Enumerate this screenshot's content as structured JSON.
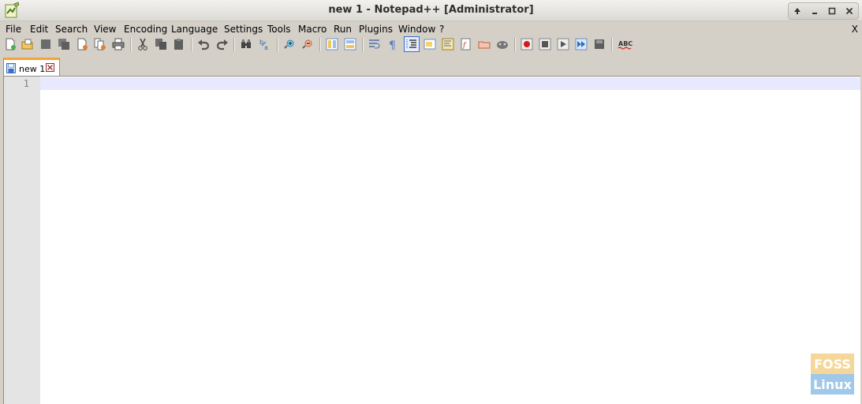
{
  "window": {
    "title": "new 1 - Notepad++ [Administrator]",
    "buttons": [
      "↑",
      "−",
      "□",
      "✕"
    ]
  },
  "menu": {
    "items": [
      "File",
      "Edit",
      "Search",
      "View",
      "Encoding",
      "Language",
      "Settings",
      "Tools",
      "Macro",
      "Run",
      "Plugins",
      "Window",
      "?"
    ],
    "close_label": "X"
  },
  "toolbar": {
    "icons": [
      "new-file-icon",
      "open-file-icon",
      "save-icon",
      "save-all-icon",
      "close-icon",
      "close-all-icon",
      "print-icon",
      "cut-icon",
      "copy-icon",
      "paste-icon",
      "undo-icon",
      "redo-icon",
      "find-icon",
      "replace-icon",
      "zoom-in-icon",
      "zoom-out-icon",
      "sync-vertical-icon",
      "sync-horizontal-icon",
      "word-wrap-icon",
      "show-all-chars-icon",
      "indent-guide-icon",
      "user-language-icon",
      "document-map-icon",
      "function-list-icon",
      "folder-as-workspace-icon",
      "monitoring-icon",
      "record-macro-icon",
      "stop-macro-icon",
      "play-macro-icon",
      "run-macro-multiple-icon",
      "save-macro-icon",
      "spell-check-icon"
    ],
    "active": "indent-guide-icon",
    "spell_label": "ABC"
  },
  "tabs": [
    {
      "label": "new 1"
    }
  ],
  "editor": {
    "line_numbers": [
      "1"
    ],
    "content": ""
  },
  "watermark": {
    "top": "FOSS",
    "bottom": "Linux"
  }
}
